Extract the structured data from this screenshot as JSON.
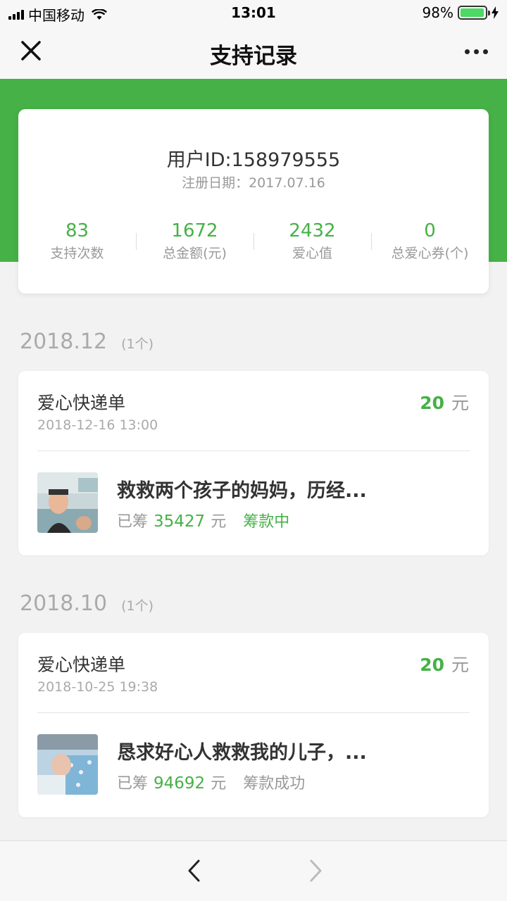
{
  "status_bar": {
    "carrier": "中国移动",
    "time": "13:01",
    "battery": "98%",
    "battery_level": 0.98
  },
  "nav": {
    "title": "支持记录",
    "close_icon": "close-icon",
    "more_icon": "more-icon"
  },
  "user": {
    "id": "用户ID:158979555",
    "reg_date": "注册日期：2017.07.16",
    "stats": [
      {
        "value": "83",
        "label": "支持次数"
      },
      {
        "value": "1672",
        "label": "总金额(元)"
      },
      {
        "value": "2432",
        "label": "爱心值"
      },
      {
        "value": "0",
        "label": "总爱心券(个)"
      }
    ]
  },
  "groups": [
    {
      "month": "2018.12",
      "count": "(1个)",
      "record": {
        "type": "爱心快递单",
        "date": "2018-12-16 13:00",
        "amount": "20",
        "unit": "元",
        "project_title": "救救两个孩子的妈妈，历经...",
        "raised_label": "已筹",
        "raised_value": "35427",
        "raised_unit": "元",
        "status": "筹款中",
        "status_color": "#46b147"
      }
    },
    {
      "month": "2018.10",
      "count": "(1个)",
      "record": {
        "type": "爱心快递单",
        "date": "2018-10-25 19:38",
        "amount": "20",
        "unit": "元",
        "project_title": "恳求好心人救救我的儿子，...",
        "raised_label": "已筹",
        "raised_value": "94692",
        "raised_unit": "元",
        "status": "筹款成功",
        "status_color": "#999999"
      }
    }
  ],
  "colors": {
    "accent": "#46b147",
    "muted": "#999999"
  }
}
